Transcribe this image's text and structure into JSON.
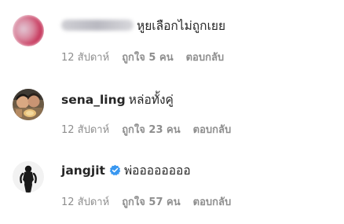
{
  "comments": [
    {
      "username": "",
      "username_hidden": true,
      "text": "หูยเลือกไม่ถูกเยย",
      "time": "12 สัปดาห์",
      "likes": "ถูกใจ 5 คน",
      "reply": "ตอบกลับ",
      "verified": false
    },
    {
      "username": "sena_ling",
      "username_hidden": false,
      "text": "หล่อทั้งคู่",
      "time": "12 สัปดาห์",
      "likes": "ถูกใจ 23 คน",
      "reply": "ตอบกลับ",
      "verified": false
    },
    {
      "username": "jangjit",
      "username_hidden": false,
      "text": "พ่ออออออออ",
      "time": "12 สัปดาห์",
      "likes": "ถูกใจ 57 คน",
      "reply": "ตอบกลับ",
      "verified": true
    }
  ],
  "colors": {
    "text": "#262626",
    "meta": "#8e8e8e",
    "verified": "#3897f0"
  }
}
